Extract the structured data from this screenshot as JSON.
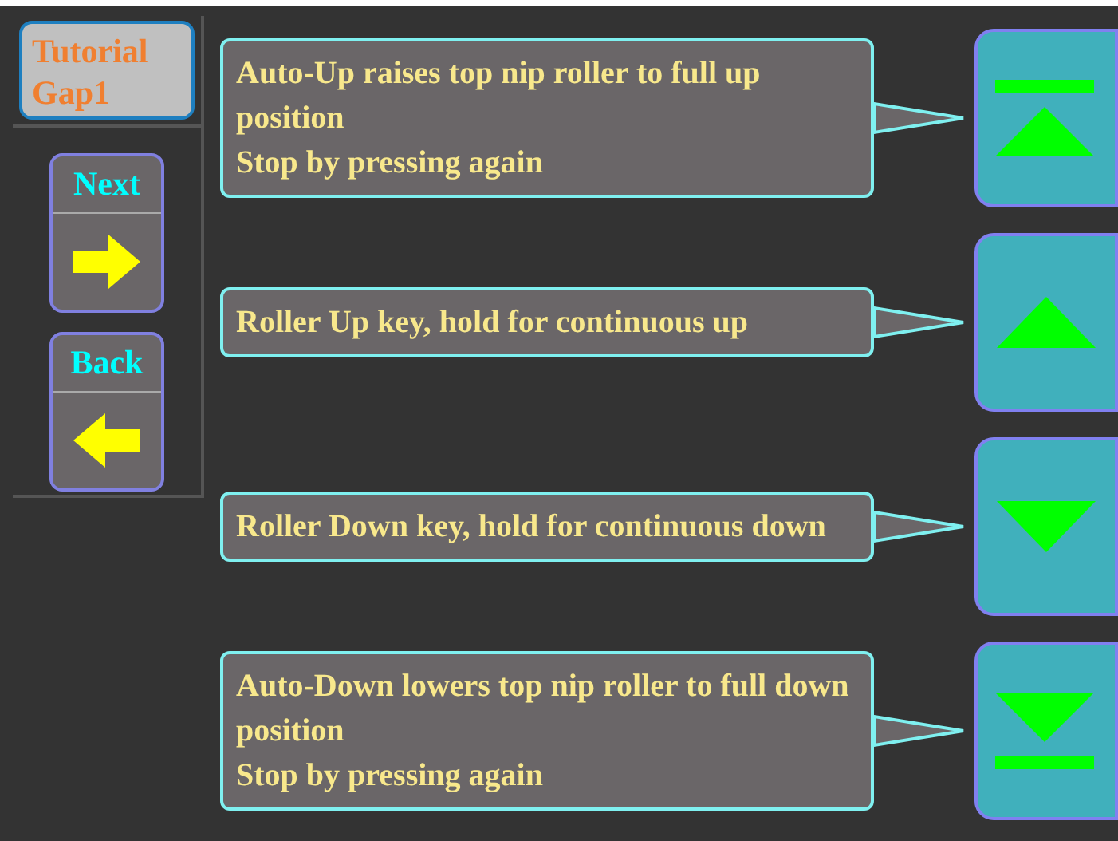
{
  "title": "Tutorial Gap1",
  "nav": [
    {
      "label": "Next",
      "kind": "next"
    },
    {
      "label": "Back",
      "kind": "back"
    }
  ],
  "rows": [
    {
      "kind": "auto-up",
      "lines": [
        "Auto-Up raises top nip roller to full up position",
        "Stop by pressing again"
      ]
    },
    {
      "kind": "up",
      "lines": [
        "Roller Up key, hold for continuous up"
      ]
    },
    {
      "kind": "down",
      "lines": [
        "Roller Down key, hold for continuous down"
      ]
    },
    {
      "kind": "auto-down",
      "lines": [
        "Auto-Down lowers top nip roller to full down position",
        "Stop by pressing again"
      ]
    }
  ]
}
